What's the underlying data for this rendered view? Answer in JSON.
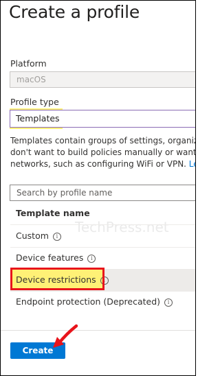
{
  "page": {
    "title": "Create a profile"
  },
  "platform": {
    "label": "Platform",
    "value": "macOS"
  },
  "profile_type": {
    "label": "Profile type",
    "value": "Templates"
  },
  "description": {
    "line1": "Templates contain groups of settings, organized",
    "line2": "don't want to build policies manually or want to",
    "line3_text": "networks, such as configuring WiFi or VPN. ",
    "line3_link": "Lea"
  },
  "search": {
    "placeholder": "Search by profile name"
  },
  "table": {
    "header": "Template name",
    "rows": [
      {
        "name": "Custom"
      },
      {
        "name": "Device features"
      },
      {
        "name": "Device restrictions"
      },
      {
        "name": "Endpoint protection (Deprecated)"
      }
    ]
  },
  "watermark": "TechPress.net",
  "actions": {
    "create_label": "Create"
  },
  "colors": {
    "accent": "#0078d4",
    "highlight": "#fff176",
    "callout": "#e8141b"
  },
  "icons": {
    "info": "info-circle-icon",
    "arrow": "red-arrow-icon"
  }
}
